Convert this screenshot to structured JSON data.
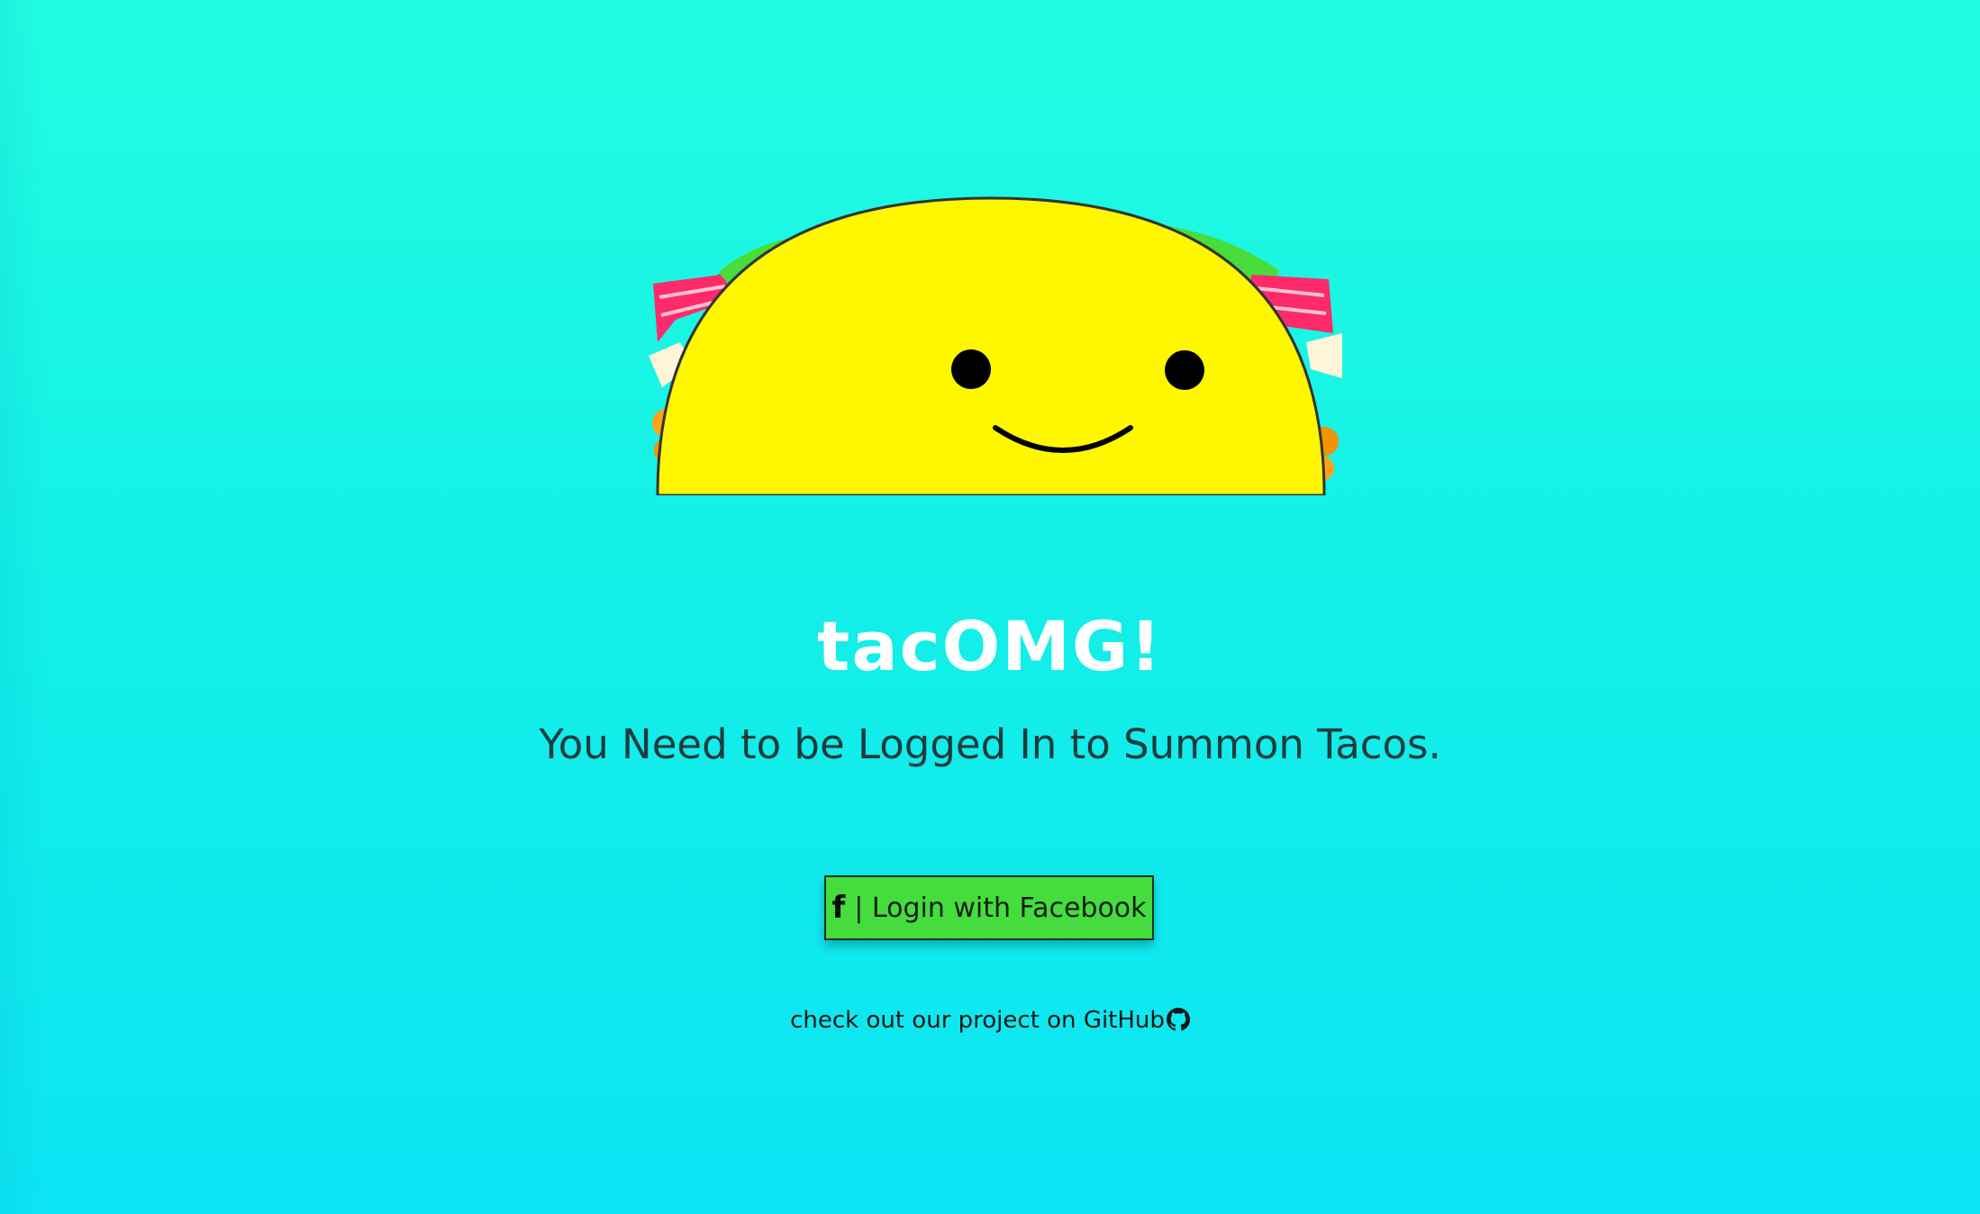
{
  "app": {
    "title": "tacOMG!",
    "subtitle": "You Need to be Logged In to Summon Tacos."
  },
  "login": {
    "icon": "facebook-icon",
    "label": "| Login with Facebook"
  },
  "footer": {
    "text": "check out our project on ",
    "link_text": "GitHub",
    "icon": "github-icon"
  },
  "colors": {
    "background_top": "#22fde2",
    "background_bottom": "#0ce4f4",
    "button_green": "#45dc3e",
    "taco_yellow": "#fff200",
    "title_white": "#ffffff"
  }
}
